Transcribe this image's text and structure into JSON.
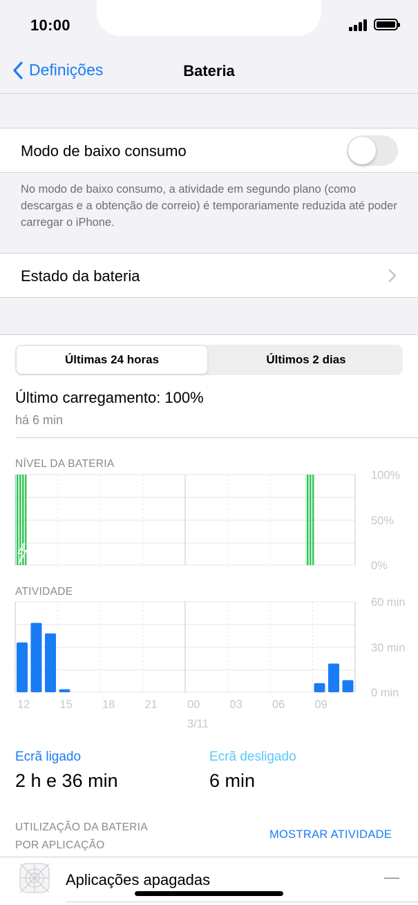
{
  "status_bar": {
    "time": "10:00"
  },
  "nav": {
    "back_label": "Definições",
    "title": "Bateria"
  },
  "low_power": {
    "label": "Modo de baixo consumo",
    "enabled": false,
    "footnote": "No modo de baixo consumo, a atividade em segundo plano (como descargas e a obtenção de correio) é temporariamente reduzida até poder carregar o iPhone."
  },
  "battery_health": {
    "label": "Estado da bateria"
  },
  "tabs": [
    {
      "label": "Últimas 24 horas",
      "selected": true
    },
    {
      "label": "Últimos 2 dias",
      "selected": false
    }
  ],
  "last_charge": {
    "title": "Último carregamento: 100%",
    "subtitle": "há 6 min"
  },
  "battery_level_chart": {
    "label": "NÍVEL DA BATERIA",
    "y_ticks": [
      "100%",
      "50%",
      "0%"
    ]
  },
  "activity_chart": {
    "label": "ATIVIDADE",
    "y_ticks": [
      "60 min",
      "30 min",
      "0 min"
    ]
  },
  "chart_data": [
    {
      "type": "area",
      "ylabel": "",
      "ylim": [
        0,
        100
      ],
      "x_ticks": [
        "12",
        "15",
        "18",
        "21",
        "00",
        "03",
        "06",
        "09"
      ],
      "charging_segments": [
        {
          "start_hour": 11.7,
          "end_hour": 12.8,
          "level": 100
        },
        {
          "start_hour": 8.5,
          "end_hour": 9.1,
          "level": 100,
          "day": "3/11"
        }
      ],
      "color": "#34c759"
    },
    {
      "type": "bar",
      "ylim": [
        0,
        60
      ],
      "unit": "min",
      "x_ticks": [
        "12",
        "15",
        "18",
        "21",
        "00",
        "03",
        "06",
        "09"
      ],
      "date_label": "3/11",
      "series": [
        {
          "values": [
            33,
            46,
            39,
            2,
            0,
            0,
            0,
            0,
            0,
            0,
            0,
            0,
            0,
            0,
            0,
            0,
            0,
            0,
            0,
            0,
            0,
            6,
            19,
            8
          ],
          "color": "#1a7cf5"
        }
      ]
    }
  ],
  "screen_on": {
    "label": "Ecrã ligado",
    "value": "2 h e 36 min"
  },
  "screen_off": {
    "label": "Ecrã desligado",
    "value": "6 min"
  },
  "usage": {
    "label_line1": "UTILIZAÇÃO DA BATERIA",
    "label_line2": "POR APLICAÇÃO",
    "action": "MOSTRAR ATIVIDADE"
  },
  "apps": [
    {
      "name": "Aplicações apagadas",
      "value": "—"
    }
  ]
}
